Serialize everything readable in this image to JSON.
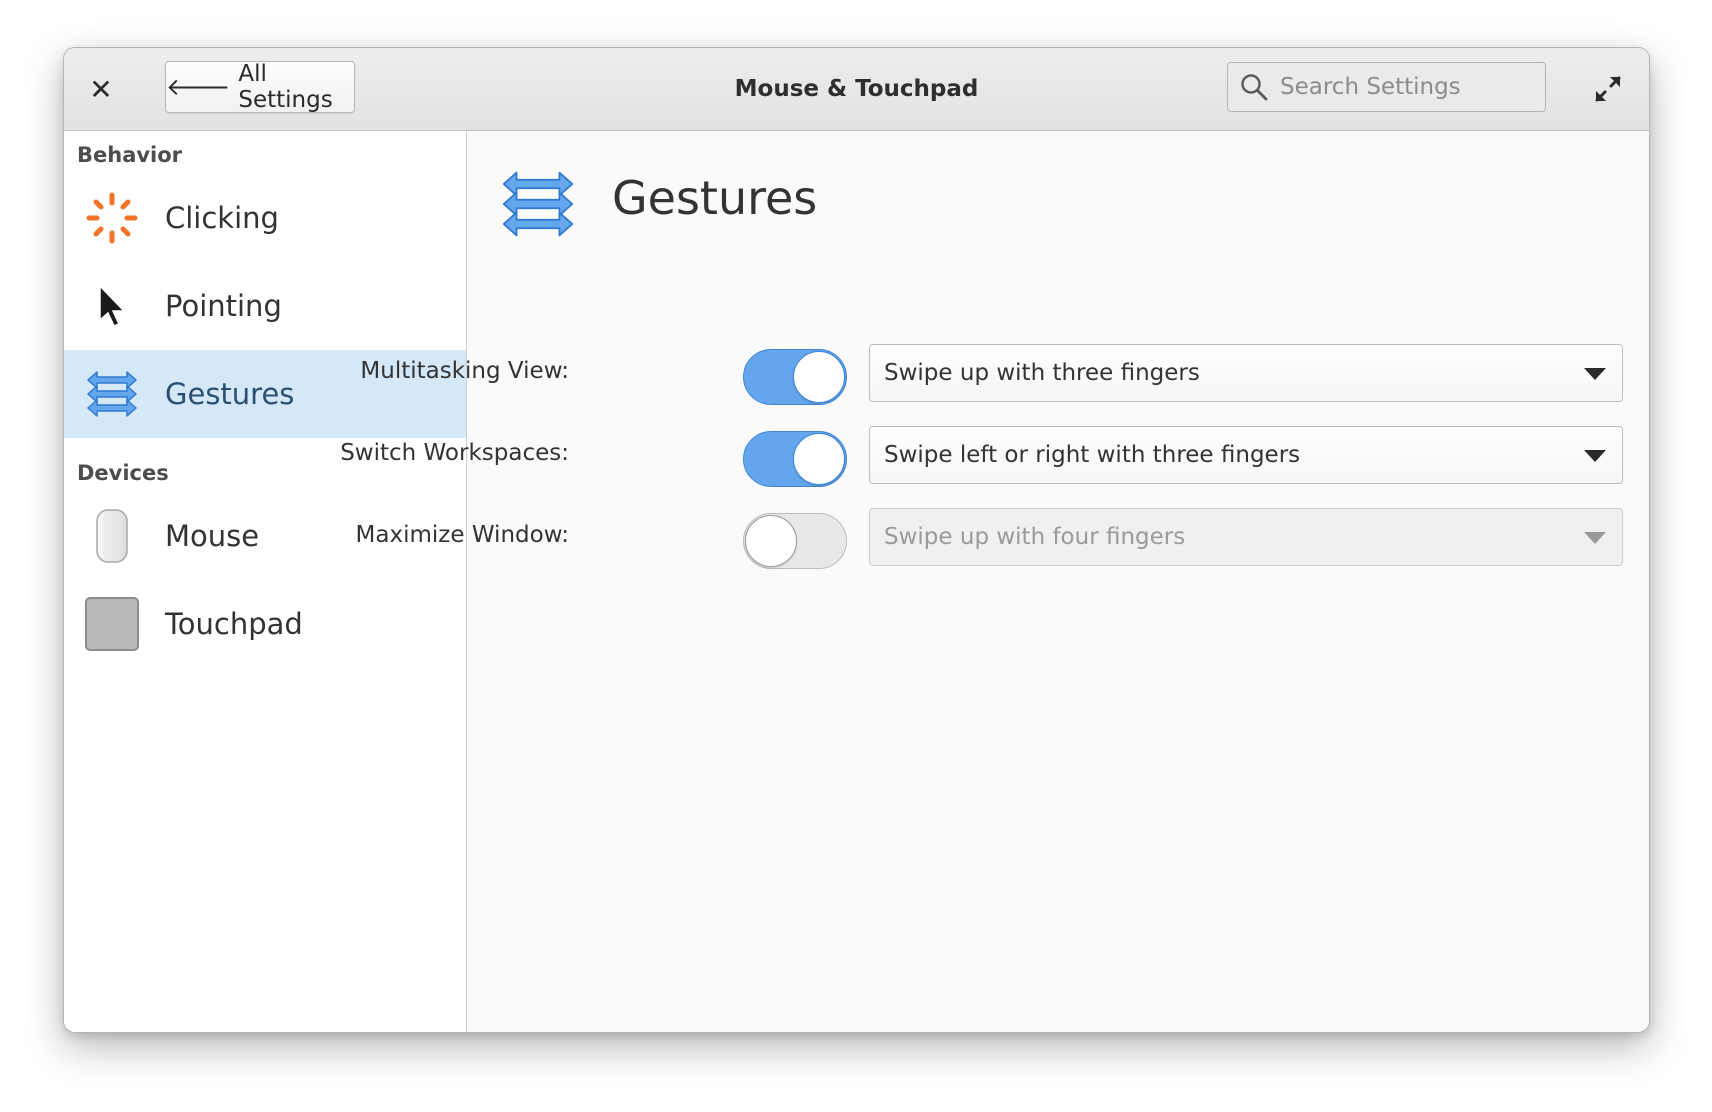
{
  "header": {
    "close_glyph": "✕",
    "back_label": "All Settings",
    "title": "Mouse & Touchpad",
    "search_placeholder": "Search Settings"
  },
  "sidebar": {
    "sections": [
      {
        "title": "Behavior",
        "items": [
          {
            "label": "Clicking",
            "icon": "clicking-icon",
            "selected": false
          },
          {
            "label": "Pointing",
            "icon": "pointer-icon",
            "selected": false
          },
          {
            "label": "Gestures",
            "icon": "gestures-icon",
            "selected": true
          }
        ]
      },
      {
        "title": "Devices",
        "items": [
          {
            "label": "Mouse",
            "icon": "mouse-icon",
            "selected": false
          },
          {
            "label": "Touchpad",
            "icon": "touchpad-icon",
            "selected": false
          }
        ]
      }
    ]
  },
  "content": {
    "title": "Gestures",
    "rows": [
      {
        "label": "Multitasking View:",
        "enabled": true,
        "value": "Swipe up with three fingers"
      },
      {
        "label": "Switch Workspaces:",
        "enabled": true,
        "value": "Swipe left or right with three fingers"
      },
      {
        "label": "Maximize Window:",
        "enabled": false,
        "value": "Swipe up with four fingers"
      }
    ]
  },
  "colors": {
    "accent": "#64a6ee",
    "selected_row": "#d4e8f8",
    "clicking_orange": "#f37329"
  }
}
